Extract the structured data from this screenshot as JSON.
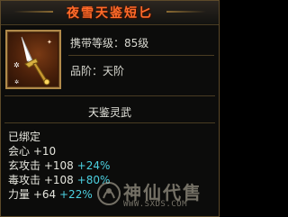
{
  "item": {
    "name": "夜雪天鉴短匕",
    "level_label": "携带等级：85级",
    "grade_label": "品阶：天阶",
    "icon": "dagger-icon"
  },
  "set_section": {
    "title": "天鉴灵武"
  },
  "stats": {
    "bound": "已绑定",
    "rows": [
      {
        "name": "会心",
        "value": "+10",
        "pct": ""
      },
      {
        "name": "玄攻击",
        "value": "+108",
        "pct": "+24%"
      },
      {
        "name": "毒攻击",
        "value": "+108",
        "pct": "+80%"
      },
      {
        "name": "力量",
        "value": "+64",
        "pct": "+22%"
      }
    ]
  },
  "watermark": {
    "main": "神仙代售",
    "sub": "WWW.SXDS.COM"
  },
  "colors": {
    "title": "#ff6a2a",
    "pct": "#4cd0e0",
    "frame": "#b18a4a"
  }
}
